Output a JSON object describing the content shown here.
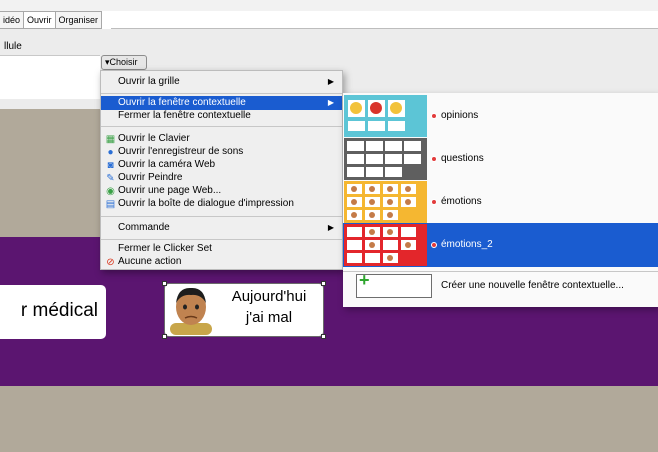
{
  "tabs": [
    {
      "label": "idéo",
      "active": false
    },
    {
      "label": "Ouvrir",
      "active": true
    },
    {
      "label": "Organiser",
      "active": false
    }
  ],
  "properties": {
    "cell_label": "llule",
    "choose_button": "▾Choisir"
  },
  "menu": {
    "open_grid": "Ouvrir la grille",
    "open_popup": "Ouvrir la fenêtre contextuelle",
    "close_popup": "Fermer la fenêtre contextuelle",
    "open_keyboard": "Ouvrir le Clavier",
    "open_recorder": "Ouvrir l'enregistreur de sons",
    "open_webcam": "Ouvrir la caméra Web",
    "open_paint": "Ouvrir Peindre",
    "open_webpage": "Ouvrir une page Web...",
    "open_print": "Ouvrir la boîte de dialogue d'impression",
    "command": "Commande",
    "close_clicker_set": "Fermer le Clicker Set",
    "no_action": "Aucune action"
  },
  "submenu": {
    "items": [
      {
        "label": "opinions",
        "highlighted": false
      },
      {
        "label": "questions",
        "highlighted": false
      },
      {
        "label": "émotions",
        "highlighted": false
      },
      {
        "label": "émotions_2",
        "highlighted": true
      }
    ],
    "create_label": "Créer une nouvelle fenêtre contextuelle..."
  },
  "canvas": {
    "cell_a_text": "r médical",
    "cell_b_line1": "Aujourd'hui",
    "cell_b_line2": "j'ai mal"
  },
  "colors": {
    "highlight": "#1a5cd0",
    "grid_background": "#5b1570",
    "workspace": "#b1a99a"
  }
}
